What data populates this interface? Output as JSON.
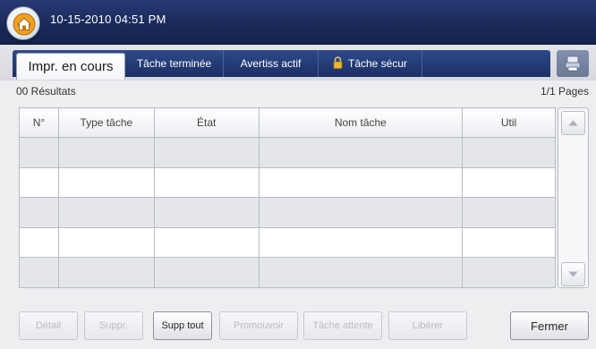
{
  "header": {
    "datetime": "10-15-2010 04:51 PM",
    "home_icon": "home-icon"
  },
  "tabs": [
    {
      "label": "Impr. en cours",
      "active": true
    },
    {
      "label": "Tâche terminée",
      "active": false
    },
    {
      "label": "Avertiss actif",
      "active": false
    },
    {
      "label": "Tâche sécur",
      "active": false,
      "icon": "lock-icon"
    }
  ],
  "summary": {
    "results": "00 Résultats",
    "pages": "1/1 Pages"
  },
  "table": {
    "columns": [
      "N°",
      "Type tâche",
      "État",
      "Nom tâche",
      "Util"
    ],
    "rows": []
  },
  "buttons": {
    "detail": "Détail",
    "delete": "Suppr.",
    "delete_all": "Supp tout",
    "promote": "Promouvoir",
    "hold": "Tâche attente",
    "release": "Libérer",
    "close": "Fermer"
  },
  "colors": {
    "header_bg": "#1b2a5a",
    "tab_strip": "#223a73",
    "active_tab": "#ffffff",
    "row_alt": "#e4e6ea"
  }
}
